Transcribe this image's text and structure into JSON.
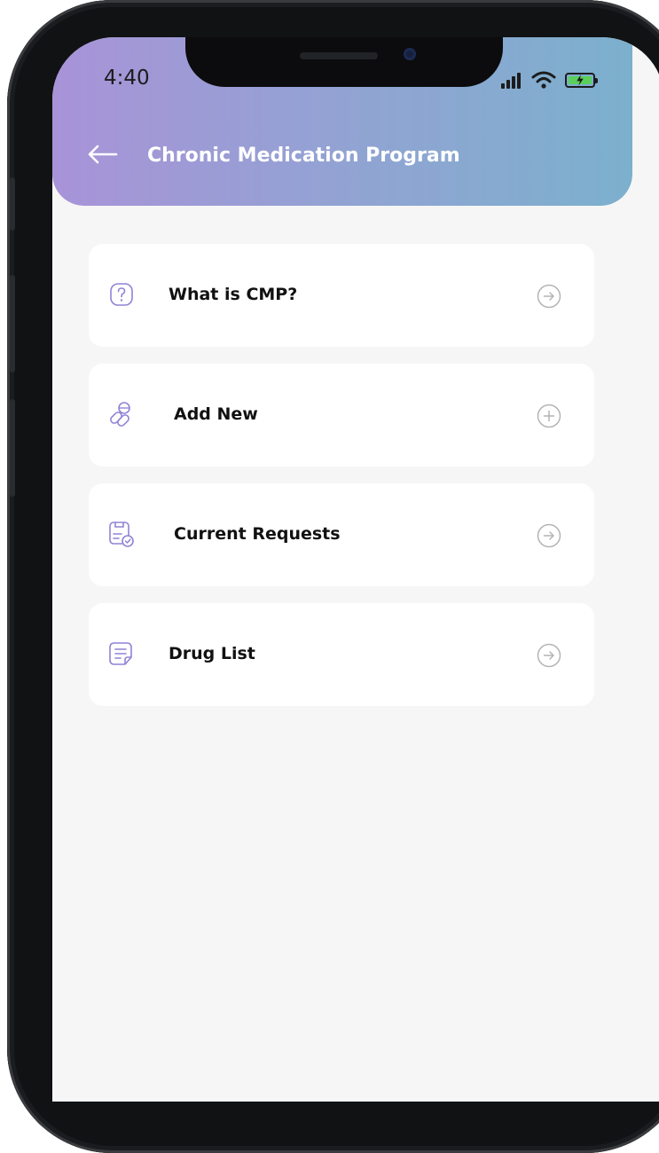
{
  "status_bar": {
    "time": "4:40",
    "icons": [
      "cellular-signal-icon",
      "wifi-icon",
      "battery-charging-icon"
    ]
  },
  "header": {
    "title": "Chronic Medication Program",
    "back_icon": "back-arrow-icon",
    "gradient": [
      "#a893d8",
      "#92a3d3",
      "#7cb0cd"
    ]
  },
  "menu": {
    "items": [
      {
        "label": "What is CMP?",
        "icon": "question-icon",
        "action_icon": "arrow-right-circle-icon"
      },
      {
        "label": "Add New",
        "icon": "pills-icon",
        "action_icon": "plus-circle-icon"
      },
      {
        "label": "Current Requests",
        "icon": "prescription-check-icon",
        "action_icon": "arrow-right-circle-icon"
      },
      {
        "label": "Drug List",
        "icon": "list-document-icon",
        "action_icon": "arrow-right-circle-icon"
      }
    ]
  },
  "colors": {
    "accent_icon": "#8f83d6",
    "action_icon": "#b4b4b4",
    "background": "#f6f6f6",
    "card": "#ffffff"
  }
}
